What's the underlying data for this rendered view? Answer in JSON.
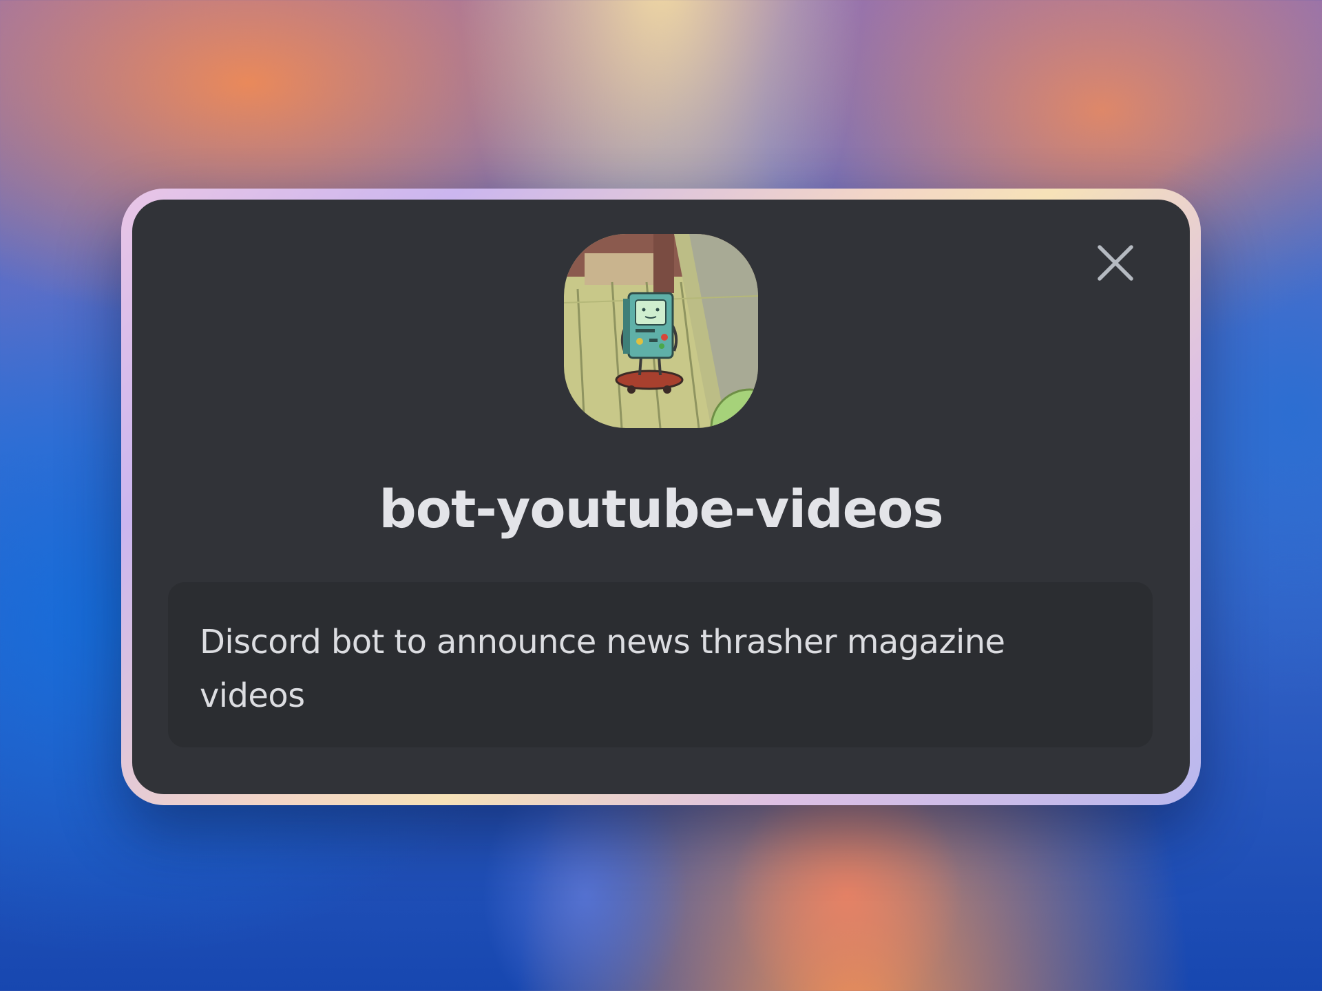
{
  "modal": {
    "channel_name": "bot-youtube-videos",
    "description": "Discord bot to announce news thrasher magazine videos",
    "close_icon": "close-icon",
    "avatar_icon": "channel-avatar"
  },
  "colors": {
    "modal_background": "#313338",
    "description_background": "#2b2d31",
    "title_text": "#e3e4e8",
    "body_text": "#dcdde1",
    "close_icon": "#b5bac1"
  }
}
